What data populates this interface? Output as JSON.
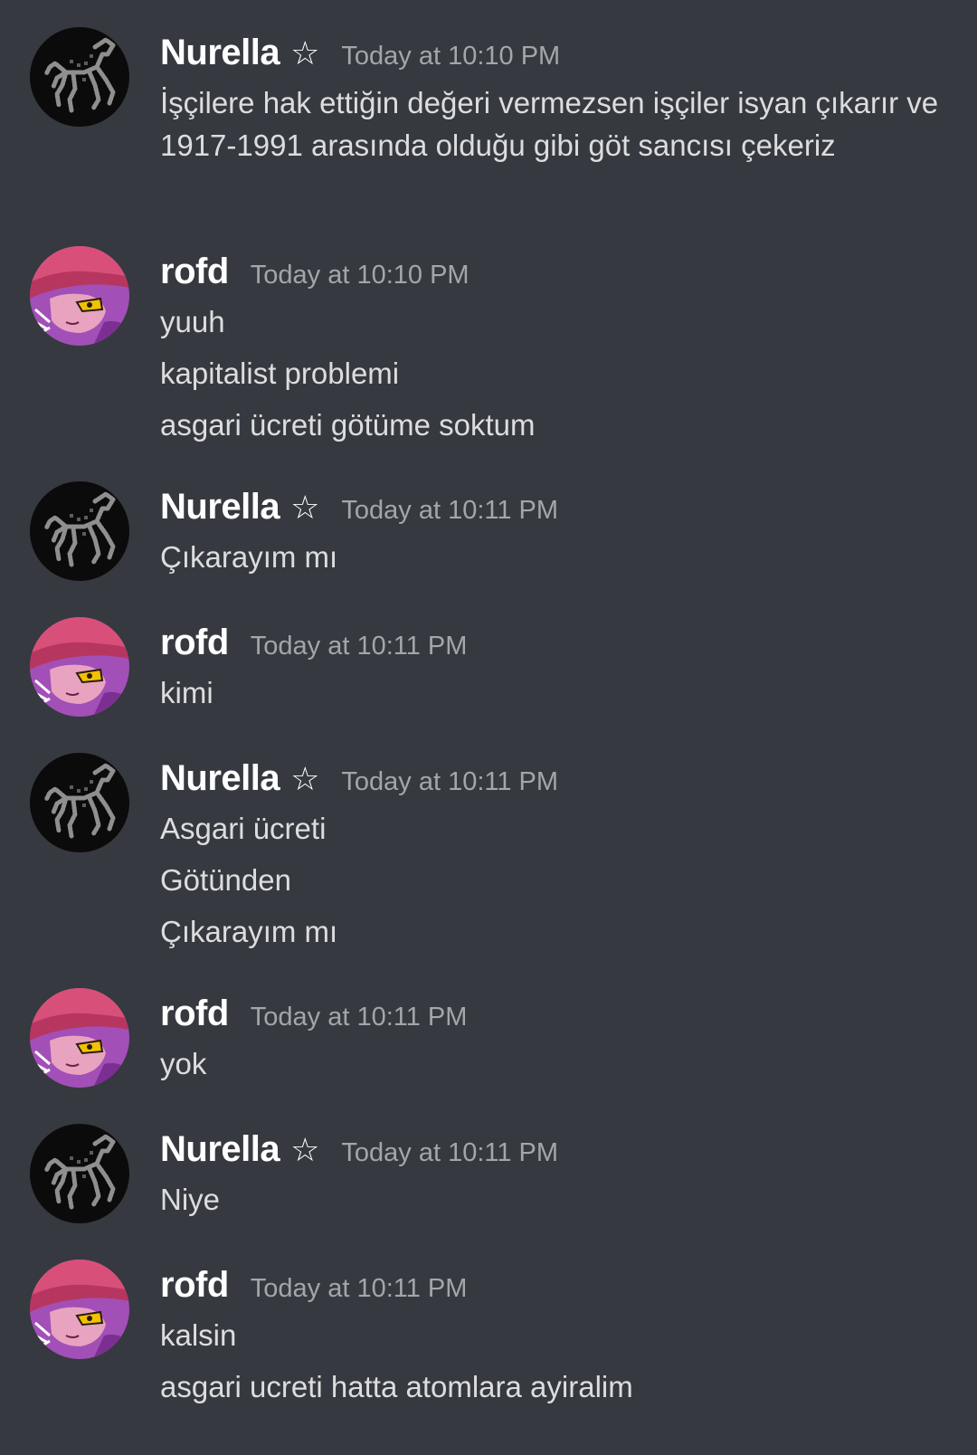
{
  "star_symbol": "☆",
  "messages": [
    {
      "author": "Nurella",
      "avatar": "horse-avatar",
      "star": true,
      "timestamp": "Today at 10:10 PM",
      "lines": [
        "İşçilere hak ettiğin değeri vermezsen işçiler isyan çıkarır ve 1917-1991 arasında olduğu gibi göt sancısı çekeriz"
      ]
    },
    {
      "author": "rofd",
      "avatar": "anime-cat-avatar",
      "star": false,
      "timestamp": "Today at 10:10 PM",
      "lines": [
        "yuuh",
        "kapitalist problemi",
        "asgari ücreti götüme soktum"
      ]
    },
    {
      "author": "Nurella",
      "avatar": "horse-avatar",
      "star": true,
      "timestamp": "Today at 10:11 PM",
      "lines": [
        "Çıkarayım mı"
      ]
    },
    {
      "author": "rofd",
      "avatar": "anime-cat-avatar",
      "star": false,
      "timestamp": "Today at 10:11 PM",
      "lines": [
        "kimi"
      ]
    },
    {
      "author": "Nurella",
      "avatar": "horse-avatar",
      "star": true,
      "timestamp": "Today at 10:11 PM",
      "lines": [
        "Asgari ücreti",
        "Götünden",
        "Çıkarayım mı"
      ]
    },
    {
      "author": "rofd",
      "avatar": "anime-cat-avatar",
      "star": false,
      "timestamp": "Today at 10:11 PM",
      "lines": [
        "yok"
      ]
    },
    {
      "author": "Nurella",
      "avatar": "horse-avatar",
      "star": true,
      "timestamp": "Today at 10:11 PM",
      "lines": [
        "Niye"
      ]
    },
    {
      "author": "rofd",
      "avatar": "anime-cat-avatar",
      "star": false,
      "timestamp": "Today at 10:11 PM",
      "lines": [
        "kalsin",
        "asgari ucreti hatta atomlara ayiralim"
      ]
    }
  ]
}
